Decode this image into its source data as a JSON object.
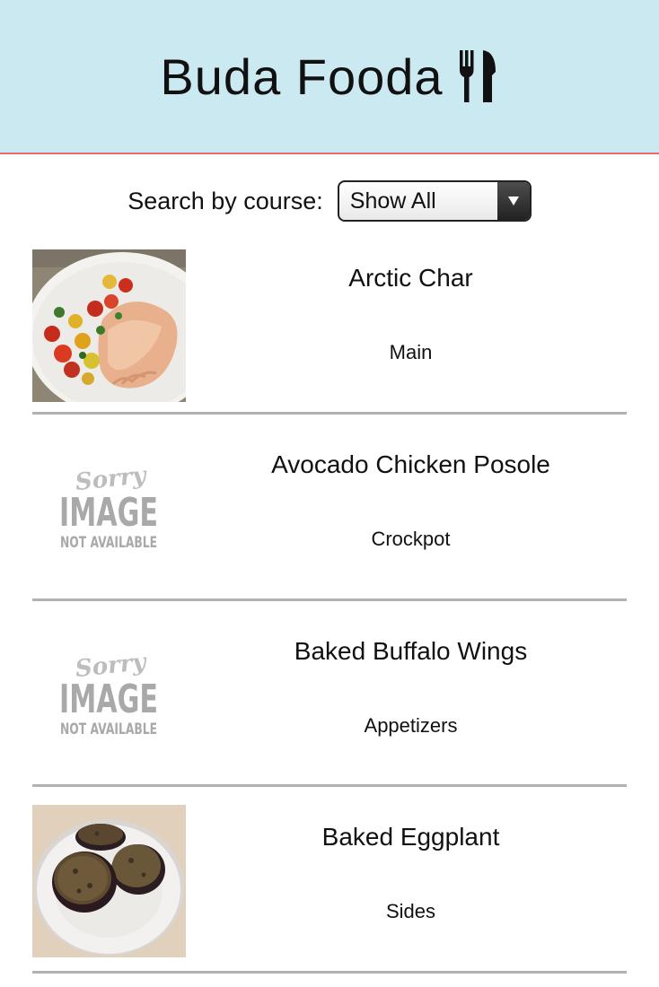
{
  "header": {
    "title": "Buda Fooda",
    "icon": "utensils-icon"
  },
  "search": {
    "label": "Search by course:",
    "selected": "Show All"
  },
  "placeholder": {
    "line1": "Sorry",
    "line2": "IMAGE",
    "line3": "NOT AVAILABLE"
  },
  "recipes": [
    {
      "name": "Arctic Char",
      "course": "Main",
      "image": "salmon-photo"
    },
    {
      "name": "Avocado Chicken Posole",
      "course": "Crockpot",
      "image": "image-not-available"
    },
    {
      "name": "Baked Buffalo Wings",
      "course": "Appetizers",
      "image": "image-not-available"
    },
    {
      "name": "Baked Eggplant",
      "course": "Sides",
      "image": "eggplant-photo"
    }
  ],
  "colors": {
    "header_bg": "#cbe9f1",
    "header_border": "#e36c6c",
    "divider": "#b2b2b2"
  }
}
